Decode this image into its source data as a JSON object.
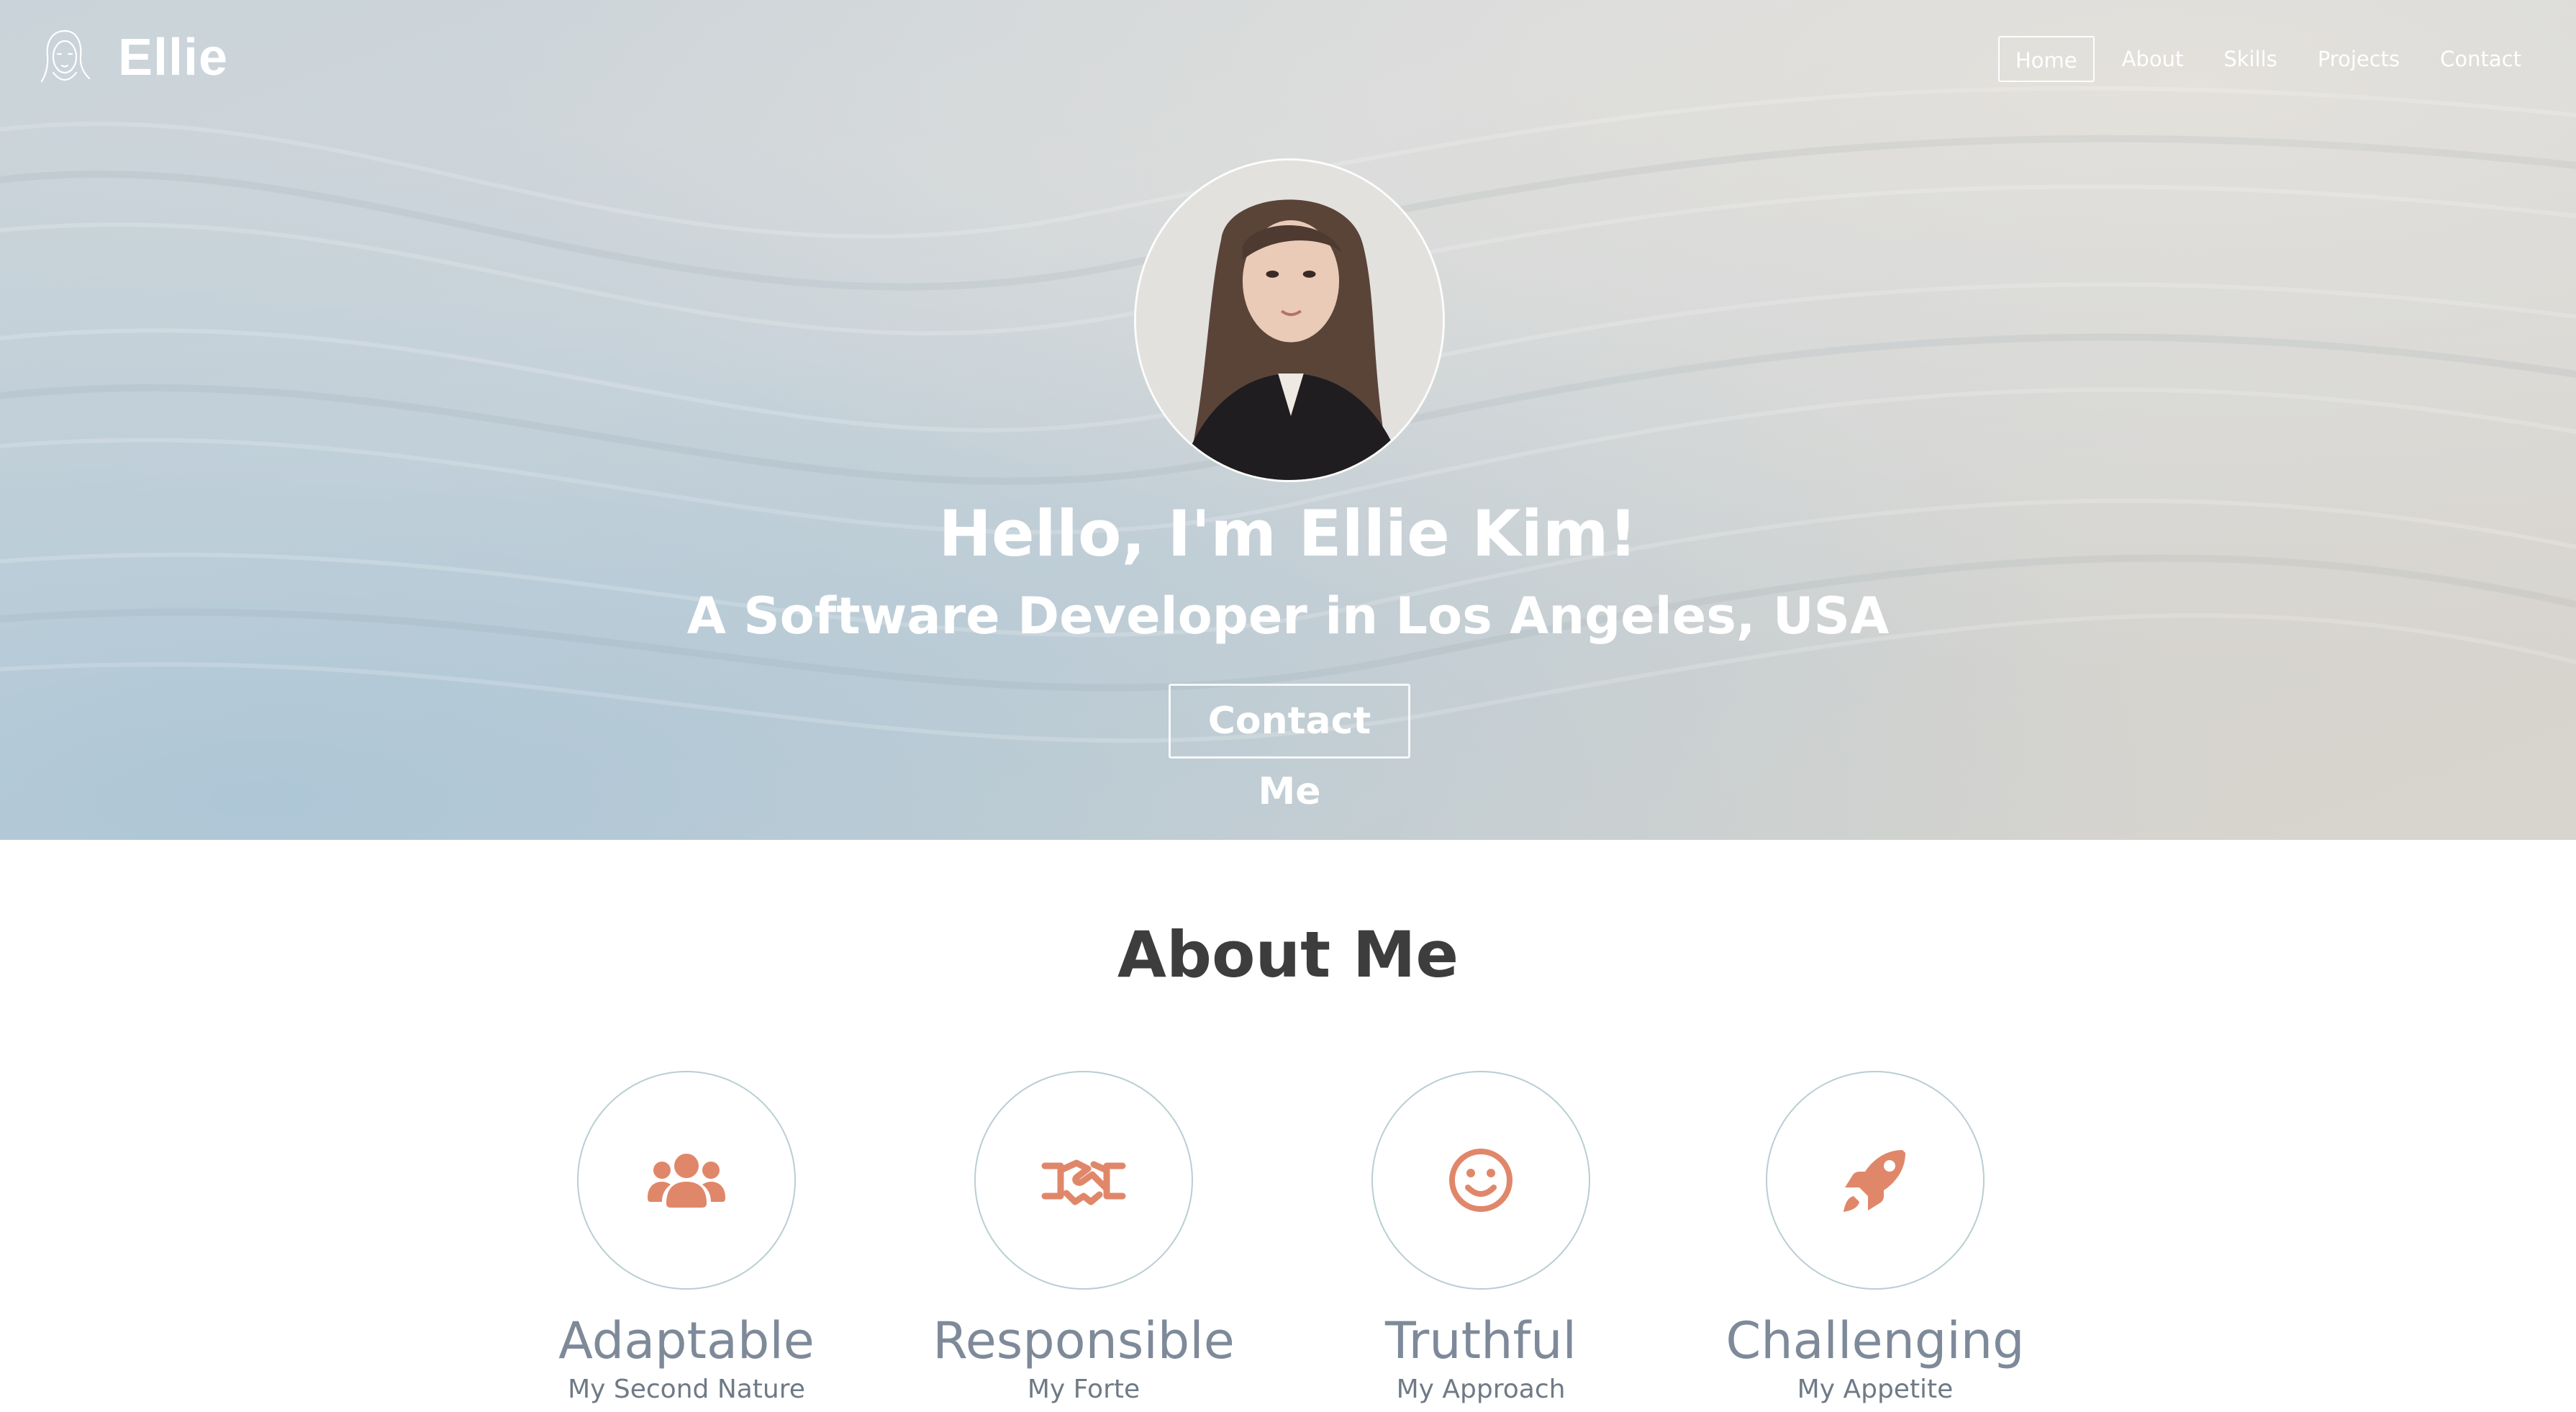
{
  "header": {
    "brand_name": "Ellie",
    "logo_icon": "ellie-face-sketch-icon"
  },
  "nav": {
    "items": [
      {
        "label": "Home",
        "active": true
      },
      {
        "label": "About",
        "active": false
      },
      {
        "label": "Skills",
        "active": false
      },
      {
        "label": "Projects",
        "active": false
      },
      {
        "label": "Contact",
        "active": false
      }
    ]
  },
  "hero": {
    "title": "Hello, I'm Ellie Kim!",
    "subtitle": "A Software Developer in Los Angeles, USA",
    "cta_label": "Contact Me",
    "avatar_icon": "profile-photo"
  },
  "about": {
    "title": "About Me",
    "traits": [
      {
        "title": "Adaptable",
        "subtitle": "My Second Nature",
        "icon": "users-group-icon"
      },
      {
        "title": "Responsible",
        "subtitle": "My Forte",
        "icon": "handshake-icon"
      },
      {
        "title": "Truthful",
        "subtitle": "My Approach",
        "icon": "smile-icon"
      },
      {
        "title": "Challenging",
        "subtitle": "My Appetite",
        "icon": "rocket-icon"
      }
    ]
  },
  "colors": {
    "accent": "#e0876a",
    "circle_border": "#b9ced3",
    "trait_title": "#7e8a99",
    "heading": "#3d3d3d"
  }
}
